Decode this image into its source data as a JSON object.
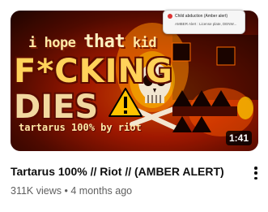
{
  "thumbnail": {
    "line1_a": "i hope",
    "line1_b": "that",
    "line1_c": "kid",
    "line2": "F*CKING",
    "line3": "DIES",
    "line4": "tartarus 100% by riot",
    "duration": "1:41",
    "alert": {
      "title": "Child abduction (Amber alert)",
      "body": "AMBER Alert : License plate, DENW..."
    }
  },
  "video": {
    "title": "Tartarus 100% // Riot // (AMBER ALERT)",
    "views": "311K views",
    "separator": "•",
    "age": "4 months ago"
  },
  "icons": {
    "menu": "more-vert-icon",
    "warning": "warning-triangle-icon",
    "skull": "skull-icon"
  },
  "colors": {
    "title": "#0f0f0f",
    "meta": "#606060",
    "thumb_fire": "#ff6a00",
    "text_yellow": "#ffd25a"
  }
}
